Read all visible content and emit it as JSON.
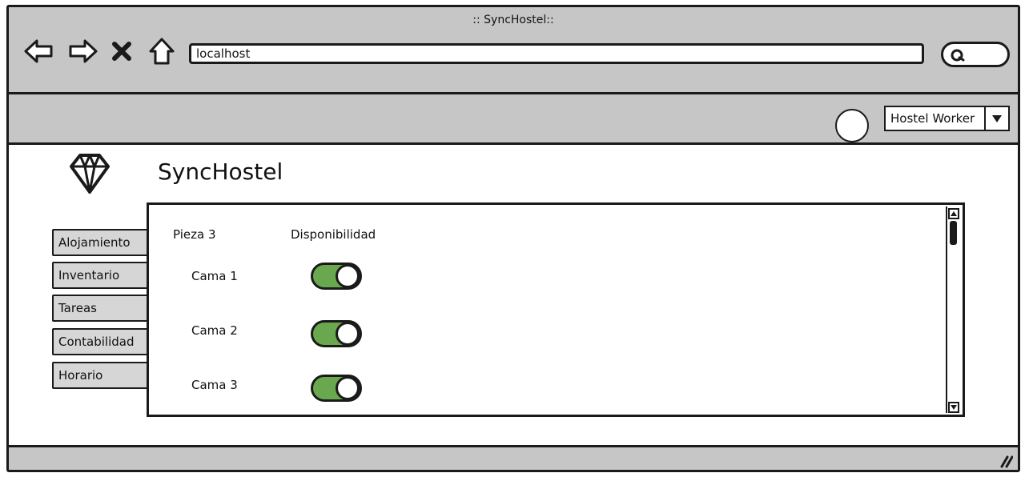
{
  "window": {
    "title": ":: SyncHostel::"
  },
  "nav": {
    "back_icon": "arrow-left-icon",
    "forward_icon": "arrow-right-icon",
    "stop_icon": "close-icon",
    "home_icon": "home-icon"
  },
  "address_bar": {
    "value": "localhost"
  },
  "search": {
    "icon": "search-icon"
  },
  "toolbar": {
    "avatar_icon": "avatar-circle",
    "role_select": {
      "selected": "Hostel Worker",
      "arrow_icon": "chevron-down-icon"
    }
  },
  "app": {
    "title": "SyncHostel",
    "logo_icon": "diamond-icon"
  },
  "sidebar": {
    "items": [
      {
        "label": "Alojamiento"
      },
      {
        "label": "Inventario"
      },
      {
        "label": "Tareas"
      },
      {
        "label": "Contabilidad"
      },
      {
        "label": "Horario"
      }
    ]
  },
  "panel": {
    "room_header": "Pieza 3",
    "availability_header": "Disponibilidad",
    "beds": [
      {
        "label": "Cama 1",
        "available": true
      },
      {
        "label": "Cama 2",
        "available": true
      },
      {
        "label": "Cama 3",
        "available": true
      }
    ]
  },
  "colors": {
    "chrome": "#c6c6c6",
    "toggle_on": "#6aa84f",
    "ink": "#1a1a1a"
  }
}
